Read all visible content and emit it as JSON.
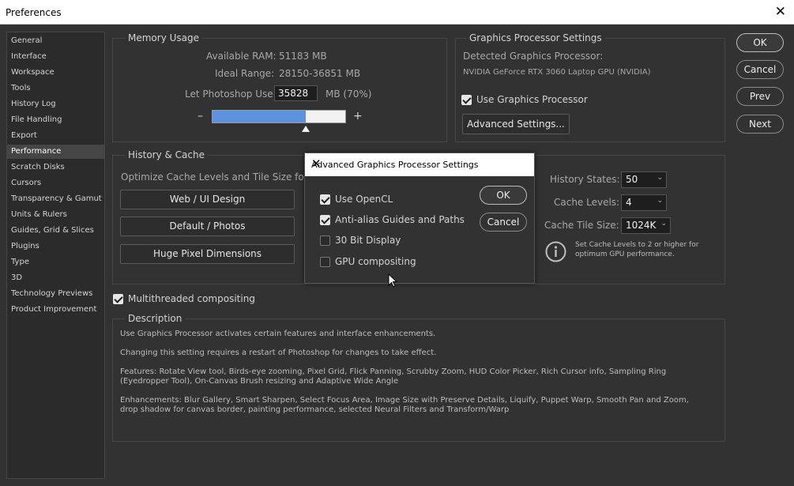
{
  "window": {
    "title": "Preferences",
    "close_glyph": "✕"
  },
  "sidebar": {
    "items": [
      {
        "label": "General"
      },
      {
        "label": "Interface"
      },
      {
        "label": "Workspace"
      },
      {
        "label": "Tools"
      },
      {
        "label": "History Log"
      },
      {
        "label": "File Handling"
      },
      {
        "label": "Export"
      },
      {
        "label": "Performance",
        "active": true
      },
      {
        "label": "Scratch Disks"
      },
      {
        "label": "Cursors"
      },
      {
        "label": "Transparency & Gamut"
      },
      {
        "label": "Units & Rulers"
      },
      {
        "label": "Guides, Grid & Slices"
      },
      {
        "label": "Plugins"
      },
      {
        "label": "Type"
      },
      {
        "label": "3D"
      },
      {
        "label": "Technology Previews"
      },
      {
        "label": "Product Improvement"
      }
    ]
  },
  "memory": {
    "title": "Memory Usage",
    "available_label": "Available RAM:",
    "available_value": "51183 MB",
    "ideal_label": "Ideal Range:",
    "ideal_value": "28150-36851 MB",
    "let_label": "Let Photoshop Use:",
    "let_value": "35828",
    "let_unit": "MB (70%)",
    "minus": "–",
    "plus": "+",
    "slider_fraction": 0.7
  },
  "gpu": {
    "title": "Graphics Processor Settings",
    "detected_label": "Detected Graphics Processor:",
    "detected_value": "NVIDIA GeForce RTX 3060 Laptop GPU (NVIDIA)",
    "use_gpu_label": "Use Graphics Processor",
    "use_gpu_checked": true,
    "advanced_button": "Advanced Settings..."
  },
  "buttons": {
    "ok": "OK",
    "cancel": "Cancel",
    "prev": "Prev",
    "next": "Next"
  },
  "history": {
    "title": "History & Cache",
    "optimize_label": "Optimize Cache Levels and Tile Size for:",
    "web_button": "Web / UI Design",
    "default_button": "Default / Photos",
    "huge_button": "Huge Pixel Dimensions",
    "states_label": "History States:",
    "states_value": "50",
    "levels_label": "Cache Levels:",
    "levels_value": "4",
    "tile_label": "Cache Tile Size:",
    "tile_value": "1024K",
    "info_text": "Set Cache Levels to 2 or higher for optimum GPU performance."
  },
  "multithreaded": {
    "label": "Multithreaded compositing",
    "checked": true
  },
  "description": {
    "title": "Description",
    "p1": "Use Graphics Processor activates certain features and interface enhancements.",
    "p2": "Changing this setting requires a restart of Photoshop for changes to take effect.",
    "p3": "Features: Rotate View tool, Birds-eye zooming, Pixel Grid, Flick Panning, Scrubby Zoom, HUD Color Picker, Rich Cursor info, Sampling Ring (Eyedropper Tool), On-Canvas Brush resizing and Adaptive Wide Angle",
    "p4": "Enhancements: Blur Gallery, Smart Sharpen, Select Focus Area, Image Size with Preserve Details, Liquify, Puppet Warp, Smooth Pan and Zoom, drop shadow for canvas border, painting performance, selected Neural Filters and Transform/Warp"
  },
  "dialog": {
    "title": "Advanced Graphics Processor Settings",
    "close_glyph": "✕",
    "options": [
      {
        "label": "Use OpenCL",
        "checked": true
      },
      {
        "label": "Anti-alias Guides and Paths",
        "checked": true
      },
      {
        "label": "30 Bit Display",
        "checked": false
      },
      {
        "label": "GPU compositing",
        "checked": false
      }
    ],
    "ok": "OK",
    "cancel": "Cancel"
  },
  "colors": {
    "slider_fill": "#5b93e0",
    "background": "#323232",
    "panel_border": "#464646"
  }
}
